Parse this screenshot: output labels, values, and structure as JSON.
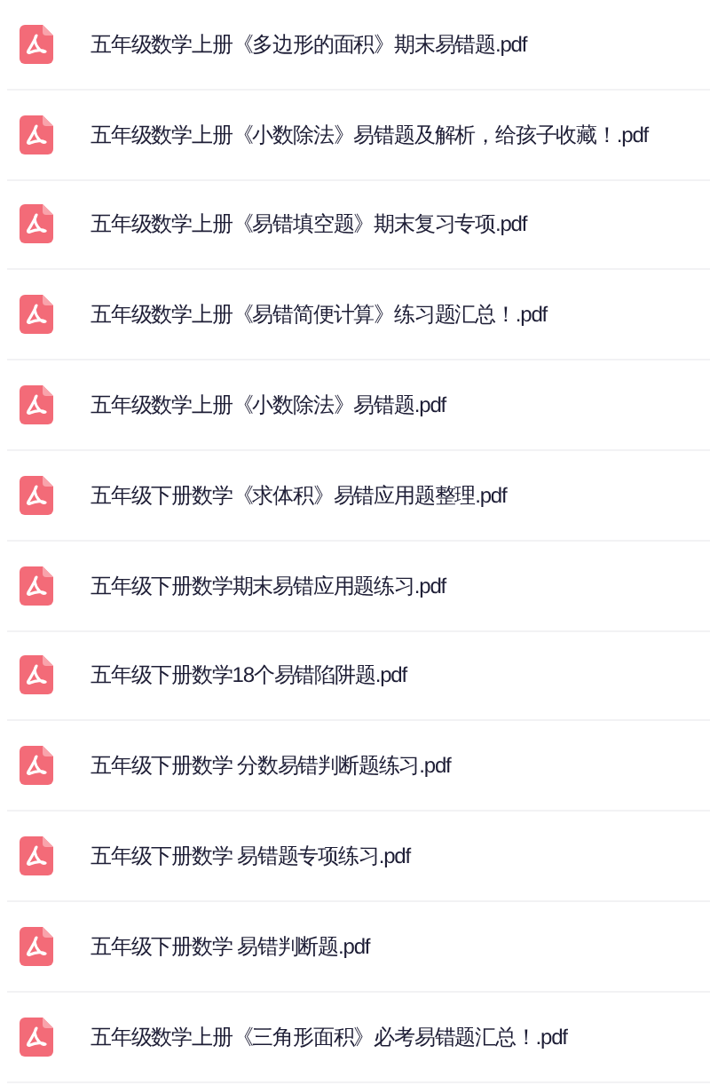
{
  "files": [
    {
      "kind": "pdf",
      "name": "五年级数学上册《多边形的面积》期末易错题.pdf"
    },
    {
      "kind": "pdf",
      "name": "五年级数学上册《小数除法》易错题及解析，给孩子收藏！.pdf"
    },
    {
      "kind": "pdf",
      "name": "五年级数学上册《易错填空题》期末复习专项.pdf"
    },
    {
      "kind": "pdf",
      "name": "五年级数学上册《易错简便计算》练习题汇总！.pdf"
    },
    {
      "kind": "pdf",
      "name": "五年级数学上册《小数除法》易错题.pdf"
    },
    {
      "kind": "pdf",
      "name": "五年级下册数学《求体积》易错应用题整理.pdf"
    },
    {
      "kind": "pdf",
      "name": "五年级下册数学期末易错应用题练习.pdf"
    },
    {
      "kind": "pdf",
      "name": "五年级下册数学18个易错陷阱题.pdf"
    },
    {
      "kind": "pdf",
      "name": "五年级下册数学 分数易错判断题练习.pdf"
    },
    {
      "kind": "pdf",
      "name": "五年级下册数学 易错题专项练习.pdf"
    },
    {
      "kind": "pdf",
      "name": "五年级下册数学 易错判断题.pdf"
    },
    {
      "kind": "pdf",
      "name": "五年级数学上册《三角形面积》必考易错题汇总！.pdf"
    }
  ]
}
